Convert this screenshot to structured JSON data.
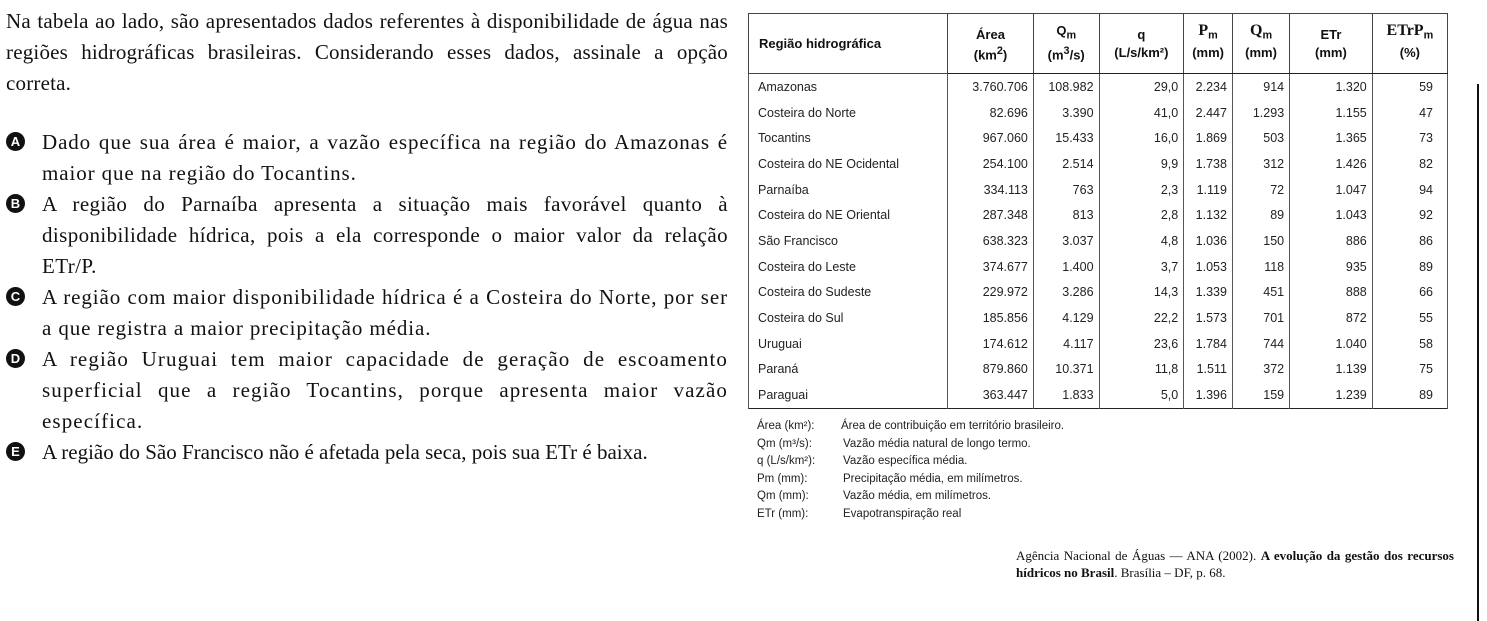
{
  "question": {
    "stem": "Na tabela ao lado, são apresentados dados referentes à disponibilidade de água nas regiões hidrográficas brasileiras. Considerando esses dados, assinale a opção correta.",
    "options": [
      {
        "letter": "A",
        "text": "Dado que sua área é maior, a vazão específica na região do Amazonas é maior que na região do Tocantins."
      },
      {
        "letter": "B",
        "text": "A região do Parnaíba apresenta a situação mais favorável quanto à disponibilidade hídrica, pois a ela corresponde o maior valor da relação ETr/P."
      },
      {
        "letter": "C",
        "text": "A região com maior disponibilidade hídrica é a Costeira do Norte, por ser a que registra a maior precipitação média."
      },
      {
        "letter": "D",
        "text": "A região Uruguai tem maior capacidade de geração de escoamento superficial que a região Tocantins, porque apresenta maior vazão específica."
      },
      {
        "letter": "E",
        "text": "A região do São Francisco não é afetada pela seca, pois sua ETr é baixa."
      }
    ]
  },
  "table": {
    "headers": {
      "region": "Região hidrográfica",
      "area": {
        "name": "Área",
        "unit_pre": "(km",
        "unit_sup": "2",
        "unit_post": ")"
      },
      "qm": {
        "sym": "Q",
        "sub": "m",
        "unit_pre": "(m",
        "unit_sup": "3",
        "unit_post": "/s)"
      },
      "q": {
        "sym": "q",
        "unit": "(L/s/km²)"
      },
      "pm": {
        "sym": "P",
        "sub": "m",
        "unit": "(mm)"
      },
      "qm_mm": {
        "sym": "Q",
        "sub": "m",
        "unit": "(mm)"
      },
      "etr": {
        "sym": "ETr",
        "unit": "(mm)"
      },
      "etrpm": {
        "sym": "ETrP",
        "sub": "m",
        "unit": "(%)"
      }
    },
    "rows": [
      {
        "region": "Amazonas",
        "area": "3.760.706",
        "qm": "108.982",
        "q": "29,0",
        "pm": "2.234",
        "qm_mm": "914",
        "etr": "1.320",
        "pct": "59"
      },
      {
        "region": "Costeira do Norte",
        "area": "82.696",
        "qm": "3.390",
        "q": "41,0",
        "pm": "2.447",
        "qm_mm": "1.293",
        "etr": "1.155",
        "pct": "47"
      },
      {
        "region": "Tocantins",
        "area": "967.060",
        "qm": "15.433",
        "q": "16,0",
        "pm": "1.869",
        "qm_mm": "503",
        "etr": "1.365",
        "pct": "73"
      },
      {
        "region": "Costeira do NE Ocidental",
        "area": "254.100",
        "qm": "2.514",
        "q": "9,9",
        "pm": "1.738",
        "qm_mm": "312",
        "etr": "1.426",
        "pct": "82"
      },
      {
        "region": "Parnaíba",
        "area": "334.113",
        "qm": "763",
        "q": "2,3",
        "pm": "1.119",
        "qm_mm": "72",
        "etr": "1.047",
        "pct": "94"
      },
      {
        "region": "Costeira do NE Oriental",
        "area": "287.348",
        "qm": "813",
        "q": "2,8",
        "pm": "1.132",
        "qm_mm": "89",
        "etr": "1.043",
        "pct": "92"
      },
      {
        "region": "São Francisco",
        "area": "638.323",
        "qm": "3.037",
        "q": "4,8",
        "pm": "1.036",
        "qm_mm": "150",
        "etr": "886",
        "pct": "86"
      },
      {
        "region": "Costeira do Leste",
        "area": "374.677",
        "qm": "1.400",
        "q": "3,7",
        "pm": "1.053",
        "qm_mm": "118",
        "etr": "935",
        "pct": "89"
      },
      {
        "region": "Costeira do Sudeste",
        "area": "229.972",
        "qm": "3.286",
        "q": "14,3",
        "pm": "1.339",
        "qm_mm": "451",
        "etr": "888",
        "pct": "66"
      },
      {
        "region": "Costeira do Sul",
        "area": "185.856",
        "qm": "4.129",
        "q": "22,2",
        "pm": "1.573",
        "qm_mm": "701",
        "etr": "872",
        "pct": "55"
      },
      {
        "region": "Uruguai",
        "area": "174.612",
        "qm": "4.117",
        "q": "23,6",
        "pm": "1.784",
        "qm_mm": "744",
        "etr": "1.040",
        "pct": "58"
      },
      {
        "region": "Paraná",
        "area": "879.860",
        "qm": "10.371",
        "q": "11,8",
        "pm": "1.511",
        "qm_mm": "372",
        "etr": "1.139",
        "pct": "75"
      },
      {
        "region": "Paraguai",
        "area": "363.447",
        "qm": "1.833",
        "q": "5,0",
        "pm": "1.396",
        "qm_mm": "159",
        "etr": "1.239",
        "pct": "89"
      }
    ]
  },
  "legend": [
    {
      "key": "Área (km²):",
      "desc": "Área de contribuição em território brasileiro."
    },
    {
      "key": "Qm (m³/s):",
      "desc": "Vazão média natural de longo termo."
    },
    {
      "key": "q (L/s/km²):",
      "desc": "Vazão específica média."
    },
    {
      "key": "Pm (mm):",
      "desc": "Precipitação média, em milímetros."
    },
    {
      "key": "Qm (mm):",
      "desc": "Vazão média, em milímetros."
    },
    {
      "key": "ETr (mm):",
      "desc": "Evapotranspiração real"
    }
  ],
  "source": {
    "prefix": "Agência Nacional de Águas — ANA (2002). ",
    "title": "A evolução da gestão dos recursos hídricos no Brasil",
    "suffix": ". Brasília – DF, p. 68."
  }
}
